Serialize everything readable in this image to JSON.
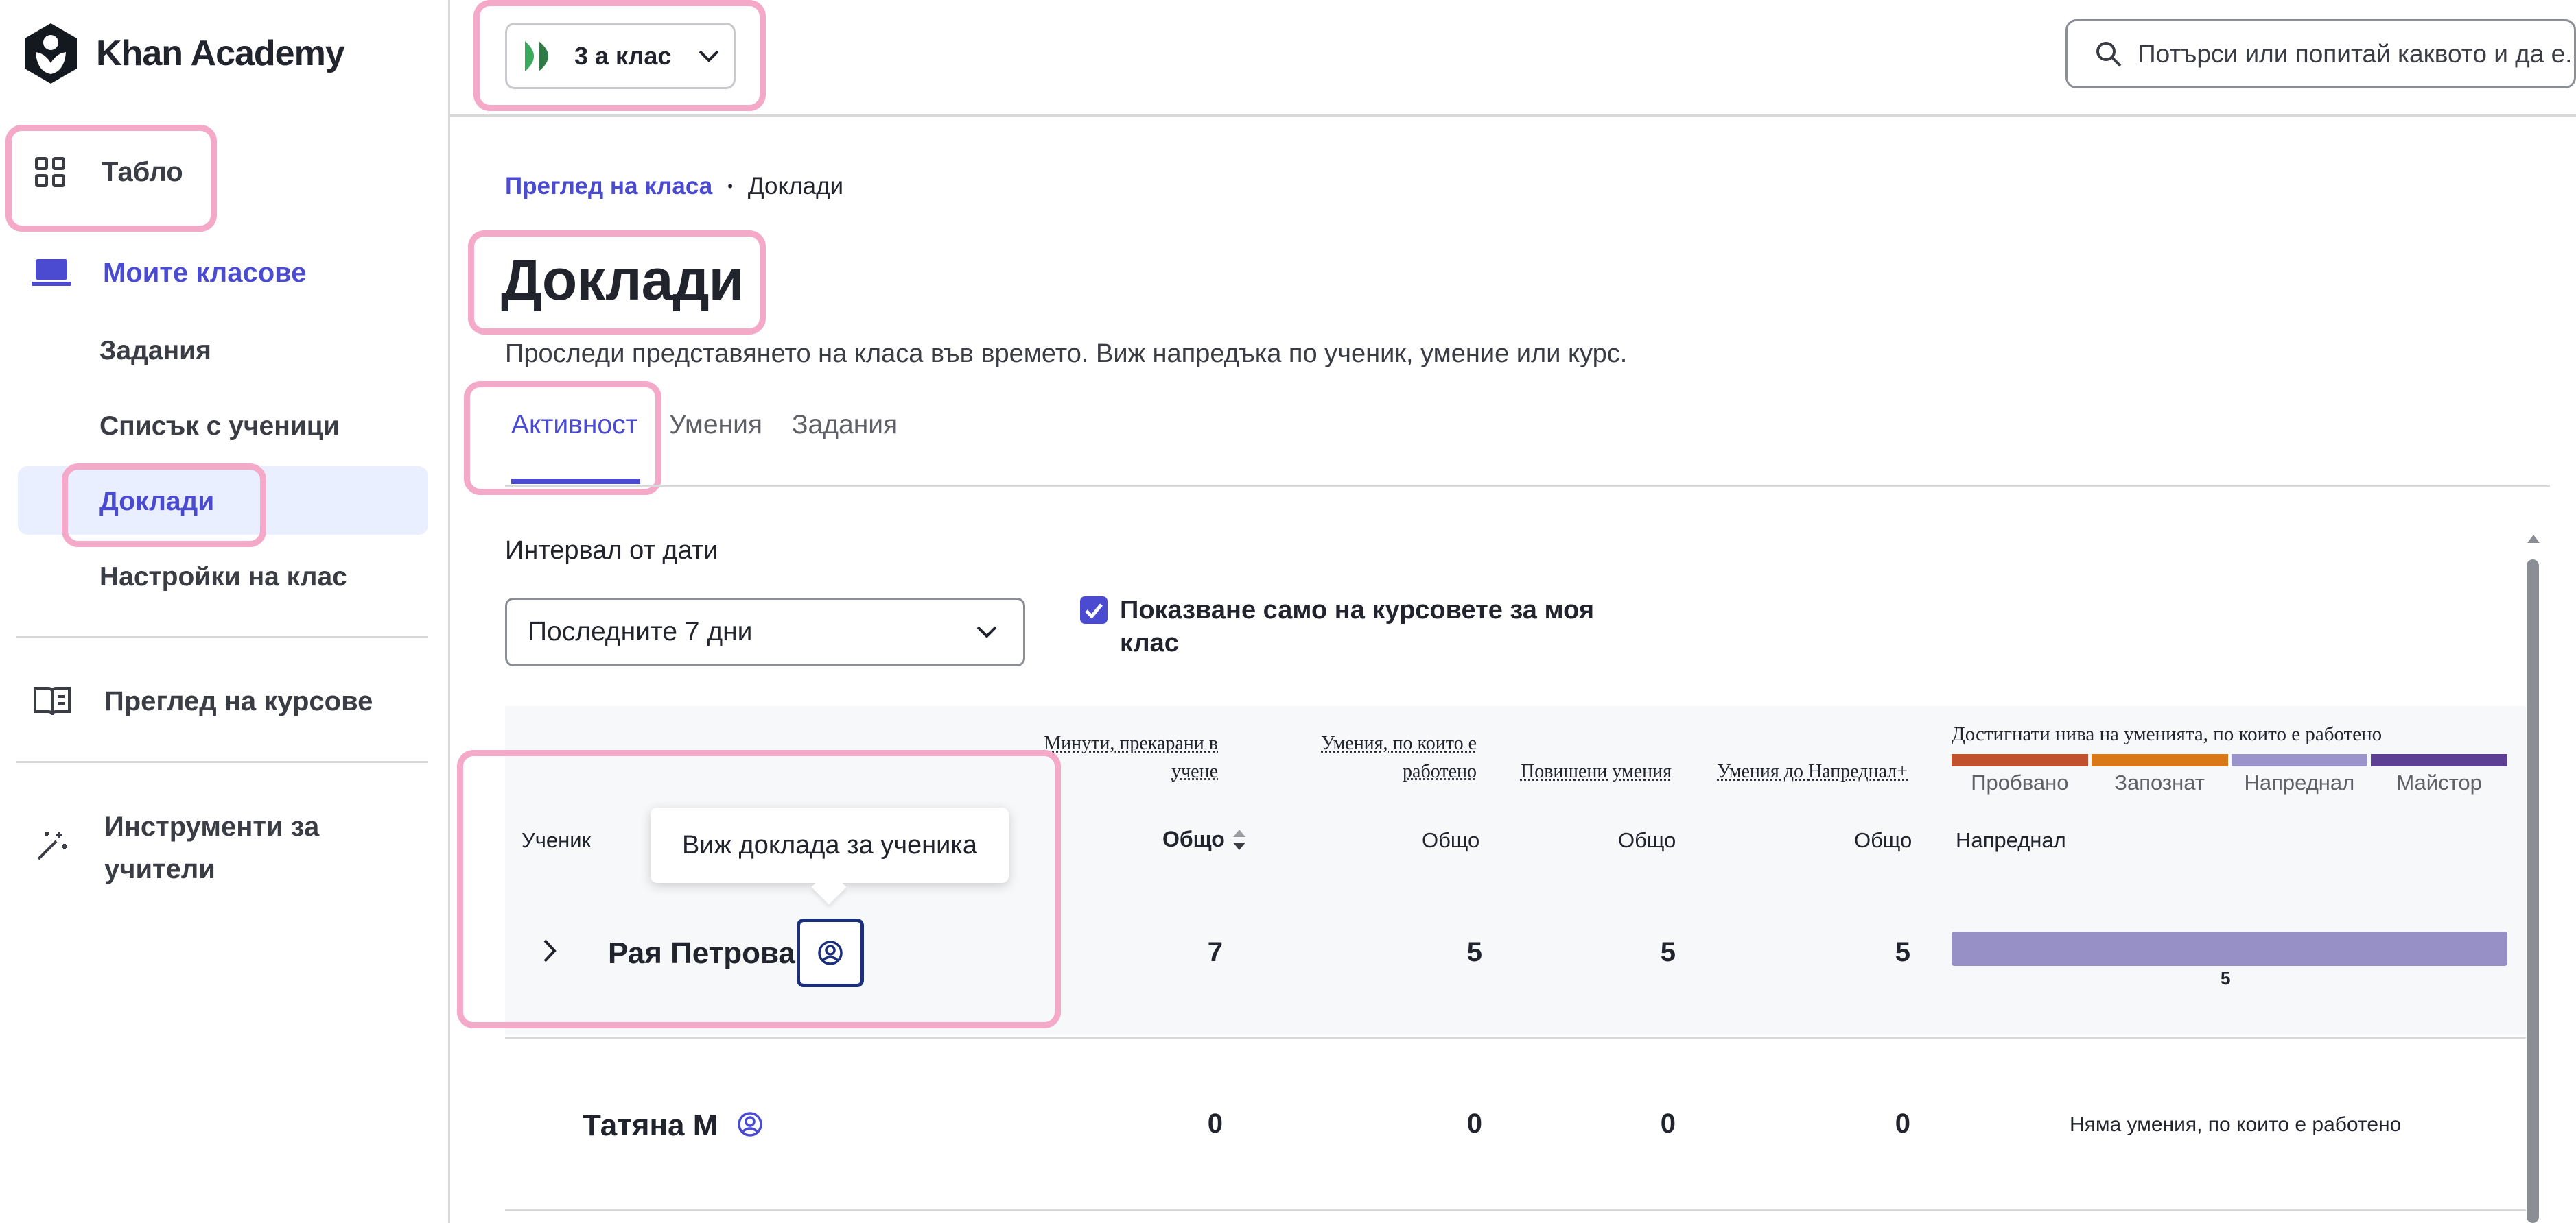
{
  "sidebar": {
    "logo_text": "Khan Academy",
    "dashboard": "Табло",
    "my_classes": "Моите класове",
    "assignments": "Задания",
    "student_list": "Списък с ученици",
    "reports": "Доклади",
    "class_settings": "Настройки на клас",
    "course_overview": "Преглед на курсове",
    "teacher_tools_line1": "Инструменти за",
    "teacher_tools_line2": "учители"
  },
  "header": {
    "class_name": "3 а клас",
    "search_placeholder": "Потърси или попитай каквото и да е..."
  },
  "breadcrumb": {
    "parent": "Преглед на класа",
    "separator": "•",
    "current": "Доклади"
  },
  "page": {
    "title": "Доклади",
    "description": "Проследи представянето на класа във времето. Виж напредъка по ученик, умение или курс."
  },
  "tabs": [
    {
      "label": "Активност",
      "active": true
    },
    {
      "label": "Умения",
      "active": false
    },
    {
      "label": "Задания",
      "active": false
    }
  ],
  "filters": {
    "date_range_label": "Интервал от дати",
    "date_range_value": "Последните 7 дни",
    "only_my_courses_line1": "Показване само на курсовете за моя",
    "only_my_courses_line2": "клас",
    "only_my_courses_checked": true
  },
  "table": {
    "col_student": "Ученик",
    "col_minutes_line1": "Минути, прекарани в",
    "col_minutes_line2": "учене",
    "col_skills_worked_line1": "Умения, по които е",
    "col_skills_worked_line2": "работено",
    "col_skills_leveled": "Повишени умения",
    "col_skills_to_proficient": "Умения до Напреднал+",
    "col_levels_title": "Достигнати нива на уменията, по които е работено",
    "levels": [
      {
        "label": "Пробвано",
        "color": "#c1502c"
      },
      {
        "label": "Запознат",
        "color": "#d97817"
      },
      {
        "label": "Напреднал",
        "color": "#9b94cb"
      },
      {
        "label": "Майстор",
        "color": "#5d3f93"
      }
    ],
    "sub_total": "Общо",
    "sub_proficient": "Напреднал",
    "tooltip": "Виж доклада за ученика",
    "rows": [
      {
        "name": "Рая Петрова",
        "minutes": "7",
        "skills_worked": "5",
        "skills_leveled": "5",
        "skills_to_proficient": "5",
        "bar_value": "5",
        "bar_fraction": 1.0
      },
      {
        "name": "Татяна М",
        "minutes": "0",
        "skills_worked": "0",
        "skills_leveled": "0",
        "skills_to_proficient": "0",
        "no_skills": "Няма умения, по които е работено"
      }
    ]
  },
  "colors": {
    "accent": "#5b5bd6",
    "highlight": "#f4a9c9",
    "active_nav_bg": "#eaefff",
    "proficient_bar": "#9690c6"
  }
}
